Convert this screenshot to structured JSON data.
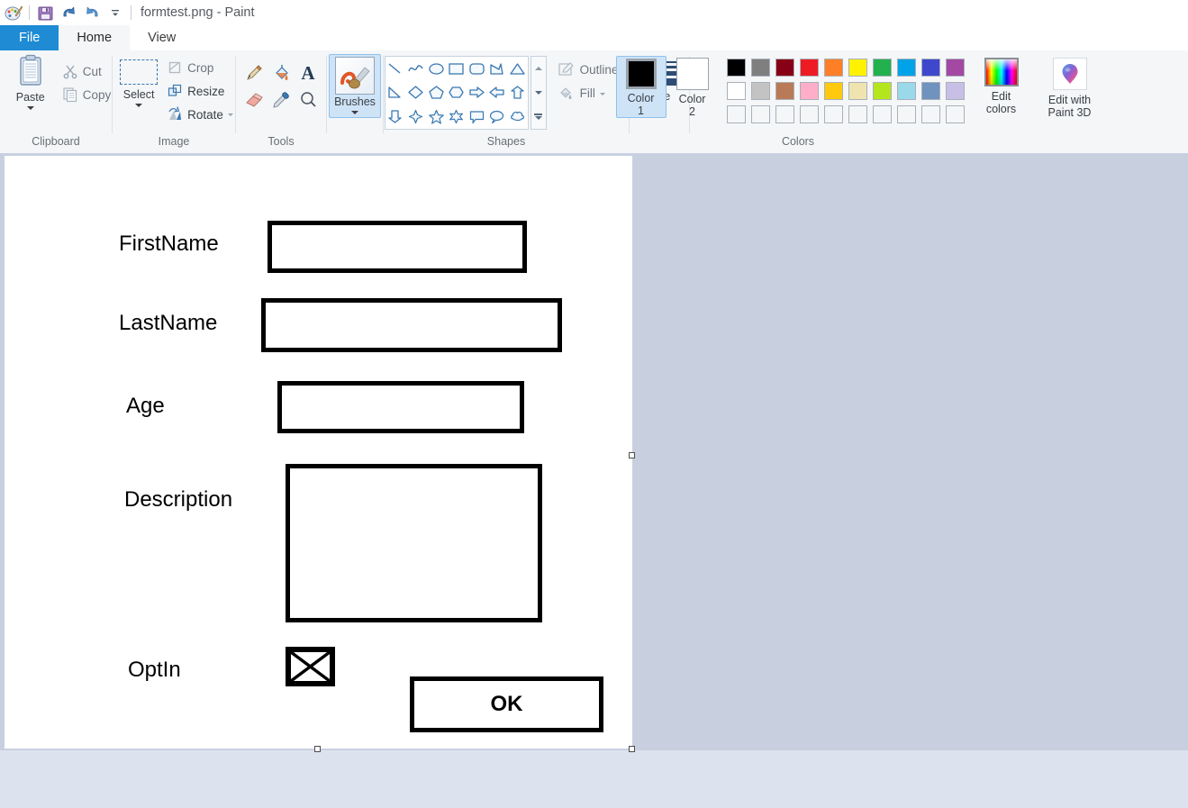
{
  "window": {
    "title": "formtest.png - Paint",
    "separator": "|"
  },
  "quick_access": {
    "items": [
      {
        "name": "paint-logo-icon",
        "label": "Paint"
      },
      {
        "name": "save-icon",
        "label": "Save"
      },
      {
        "name": "undo-icon",
        "label": "Undo"
      },
      {
        "name": "redo-icon",
        "label": "Redo"
      },
      {
        "name": "customize-quick-access-icon",
        "label": "Customize Quick Access Toolbar"
      }
    ]
  },
  "tabs": [
    {
      "label": "File",
      "state": "file"
    },
    {
      "label": "Home",
      "state": "active"
    },
    {
      "label": "View",
      "state": "inactive"
    }
  ],
  "ribbon": {
    "clipboard": {
      "label": "Clipboard",
      "paste": "Paste",
      "cut": "Cut",
      "copy": "Copy"
    },
    "image": {
      "label": "Image",
      "select": "Select",
      "crop": "Crop",
      "resize": "Resize",
      "rotate": "Rotate"
    },
    "tools": {
      "label": "Tools",
      "items": [
        {
          "name": "pencil-icon",
          "label": "Pencil"
        },
        {
          "name": "fill-with-color-icon",
          "label": "Fill with color"
        },
        {
          "name": "text-icon",
          "label": "Text"
        },
        {
          "name": "eraser-icon",
          "label": "Eraser"
        },
        {
          "name": "color-picker-icon",
          "label": "Color picker"
        },
        {
          "name": "magnifier-icon",
          "label": "Magnifier"
        }
      ]
    },
    "brushes": {
      "label": "Brushes"
    },
    "shapes": {
      "label": "Shapes",
      "items": [
        "line",
        "curve",
        "oval",
        "rectangle",
        "rounded-rectangle",
        "polygon",
        "triangle",
        "right-triangle",
        "diamond",
        "pentagon",
        "hexagon",
        "right-arrow",
        "left-arrow",
        "up-arrow",
        "down-arrow",
        "four-point-star",
        "five-point-star",
        "six-point-star",
        "rounded-rectangular-callout",
        "oval-callout",
        "cloud-callout"
      ],
      "outline": "Outline",
      "fill": "Fill"
    },
    "size": {
      "label": "Size"
    },
    "colors": {
      "label": "Colors",
      "color1": {
        "caption_line1": "Color",
        "caption_line2": "1",
        "value": "#000000",
        "selected": true
      },
      "color2": {
        "caption_line1": "Color",
        "caption_line2": "2",
        "value": "#ffffff",
        "selected": false
      },
      "palette_row1": [
        "#000000",
        "#7f7f7f",
        "#880015",
        "#ed1c24",
        "#ff7f27",
        "#fff200",
        "#22b14c",
        "#00a2e8",
        "#3f48cc",
        "#a349a4"
      ],
      "palette_row2": [
        "#ffffff",
        "#c3c3c3",
        "#b97a57",
        "#ffaec9",
        "#ffc90e",
        "#efe4b0",
        "#b5e61d",
        "#99d9ea",
        "#7092be",
        "#c8bfe7"
      ],
      "palette_row3": [
        "#f4f6f8",
        "#f4f6f8",
        "#f4f6f8",
        "#f4f6f8",
        "#f4f6f8",
        "#f4f6f8",
        "#f4f6f8",
        "#f4f6f8",
        "#f4f6f8",
        "#f4f6f8"
      ],
      "edit_colors_line1": "Edit",
      "edit_colors_line2": "colors",
      "paint3d_line1": "Edit with",
      "paint3d_line2": "Paint 3D"
    }
  },
  "canvas": {
    "drawing": {
      "fields": [
        {
          "label": "FirstName",
          "box": "text-input-box"
        },
        {
          "label": "LastName",
          "box": "text-input-box"
        },
        {
          "label": "Age",
          "box": "text-input-box"
        },
        {
          "label": "Description",
          "box": "text-area-box"
        },
        {
          "label": "OptIn",
          "box": "checkbox-checked"
        }
      ],
      "ok_button": "OK"
    },
    "selection_handles": [
      "right-middle",
      "bottom-center",
      "bottom-right"
    ]
  }
}
